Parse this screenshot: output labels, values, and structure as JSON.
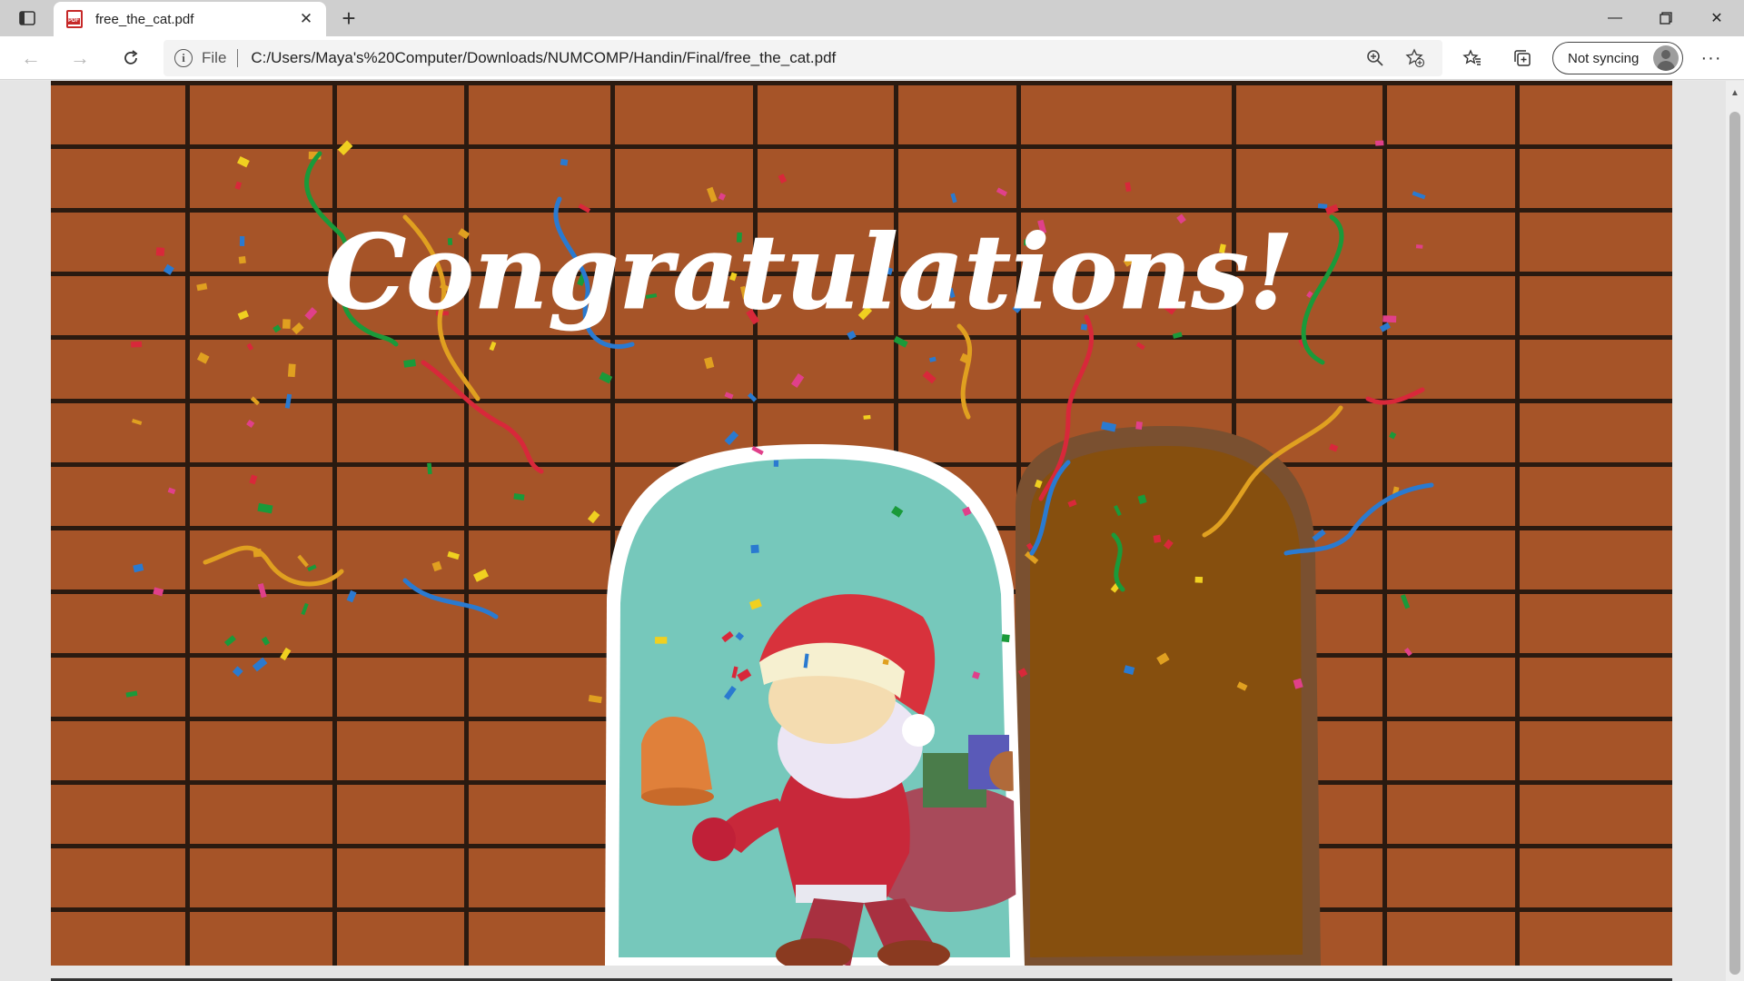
{
  "browser": {
    "tab": {
      "title": "free_the_cat.pdf"
    },
    "address": {
      "scheme": "File",
      "url": "C:/Users/Maya's%20Computer/Downloads/NUMCOMP/Handin/Final/free_the_cat.pdf"
    },
    "profile": {
      "label": "Not syncing"
    }
  },
  "document": {
    "heading": "Congratulations!",
    "colors": {
      "brick": "#a65428",
      "mortar": "#2a1a10",
      "window_fill": "#76c8bb",
      "door": "#864f0e",
      "door_frame": "#7a5030"
    }
  },
  "icons": {
    "tab_actions": "tab-actions-icon",
    "pdf": "pdf-file-icon",
    "back": "back-arrow-icon",
    "forward": "forward-arrow-icon",
    "refresh": "refresh-icon",
    "info": "info-icon",
    "zoom": "zoom-icon",
    "add_favorite": "add-favorite-icon",
    "favorites": "favorites-icon",
    "collections": "collections-icon",
    "more": "more-icon"
  }
}
